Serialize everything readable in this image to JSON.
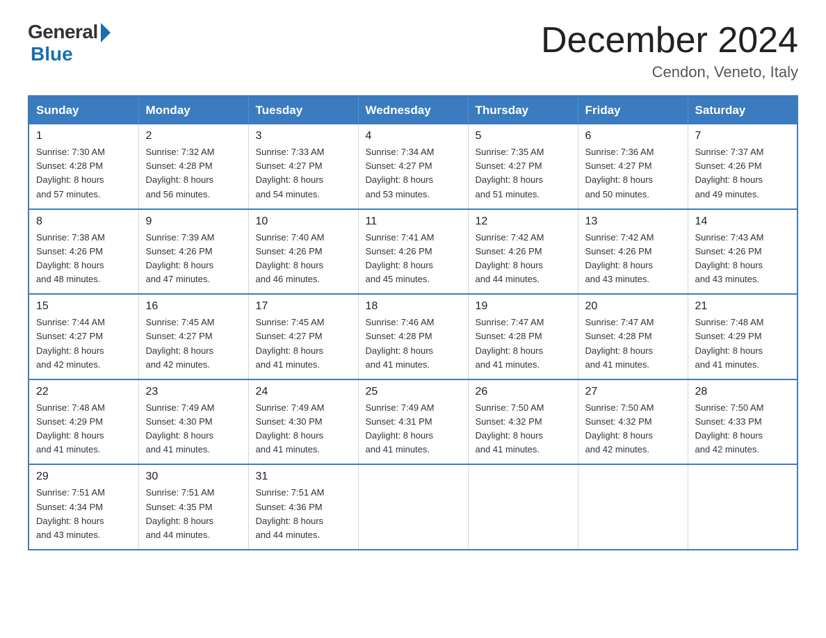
{
  "logo": {
    "general_text": "General",
    "blue_text": "Blue"
  },
  "title": "December 2024",
  "subtitle": "Cendon, Veneto, Italy",
  "days_of_week": [
    "Sunday",
    "Monday",
    "Tuesday",
    "Wednesday",
    "Thursday",
    "Friday",
    "Saturday"
  ],
  "weeks": [
    [
      {
        "day": "1",
        "sunrise": "Sunrise: 7:30 AM",
        "sunset": "Sunset: 4:28 PM",
        "daylight": "Daylight: 8 hours",
        "daylight2": "and 57 minutes."
      },
      {
        "day": "2",
        "sunrise": "Sunrise: 7:32 AM",
        "sunset": "Sunset: 4:28 PM",
        "daylight": "Daylight: 8 hours",
        "daylight2": "and 56 minutes."
      },
      {
        "day": "3",
        "sunrise": "Sunrise: 7:33 AM",
        "sunset": "Sunset: 4:27 PM",
        "daylight": "Daylight: 8 hours",
        "daylight2": "and 54 minutes."
      },
      {
        "day": "4",
        "sunrise": "Sunrise: 7:34 AM",
        "sunset": "Sunset: 4:27 PM",
        "daylight": "Daylight: 8 hours",
        "daylight2": "and 53 minutes."
      },
      {
        "day": "5",
        "sunrise": "Sunrise: 7:35 AM",
        "sunset": "Sunset: 4:27 PM",
        "daylight": "Daylight: 8 hours",
        "daylight2": "and 51 minutes."
      },
      {
        "day": "6",
        "sunrise": "Sunrise: 7:36 AM",
        "sunset": "Sunset: 4:27 PM",
        "daylight": "Daylight: 8 hours",
        "daylight2": "and 50 minutes."
      },
      {
        "day": "7",
        "sunrise": "Sunrise: 7:37 AM",
        "sunset": "Sunset: 4:26 PM",
        "daylight": "Daylight: 8 hours",
        "daylight2": "and 49 minutes."
      }
    ],
    [
      {
        "day": "8",
        "sunrise": "Sunrise: 7:38 AM",
        "sunset": "Sunset: 4:26 PM",
        "daylight": "Daylight: 8 hours",
        "daylight2": "and 48 minutes."
      },
      {
        "day": "9",
        "sunrise": "Sunrise: 7:39 AM",
        "sunset": "Sunset: 4:26 PM",
        "daylight": "Daylight: 8 hours",
        "daylight2": "and 47 minutes."
      },
      {
        "day": "10",
        "sunrise": "Sunrise: 7:40 AM",
        "sunset": "Sunset: 4:26 PM",
        "daylight": "Daylight: 8 hours",
        "daylight2": "and 46 minutes."
      },
      {
        "day": "11",
        "sunrise": "Sunrise: 7:41 AM",
        "sunset": "Sunset: 4:26 PM",
        "daylight": "Daylight: 8 hours",
        "daylight2": "and 45 minutes."
      },
      {
        "day": "12",
        "sunrise": "Sunrise: 7:42 AM",
        "sunset": "Sunset: 4:26 PM",
        "daylight": "Daylight: 8 hours",
        "daylight2": "and 44 minutes."
      },
      {
        "day": "13",
        "sunrise": "Sunrise: 7:42 AM",
        "sunset": "Sunset: 4:26 PM",
        "daylight": "Daylight: 8 hours",
        "daylight2": "and 43 minutes."
      },
      {
        "day": "14",
        "sunrise": "Sunrise: 7:43 AM",
        "sunset": "Sunset: 4:26 PM",
        "daylight": "Daylight: 8 hours",
        "daylight2": "and 43 minutes."
      }
    ],
    [
      {
        "day": "15",
        "sunrise": "Sunrise: 7:44 AM",
        "sunset": "Sunset: 4:27 PM",
        "daylight": "Daylight: 8 hours",
        "daylight2": "and 42 minutes."
      },
      {
        "day": "16",
        "sunrise": "Sunrise: 7:45 AM",
        "sunset": "Sunset: 4:27 PM",
        "daylight": "Daylight: 8 hours",
        "daylight2": "and 42 minutes."
      },
      {
        "day": "17",
        "sunrise": "Sunrise: 7:45 AM",
        "sunset": "Sunset: 4:27 PM",
        "daylight": "Daylight: 8 hours",
        "daylight2": "and 41 minutes."
      },
      {
        "day": "18",
        "sunrise": "Sunrise: 7:46 AM",
        "sunset": "Sunset: 4:28 PM",
        "daylight": "Daylight: 8 hours",
        "daylight2": "and 41 minutes."
      },
      {
        "day": "19",
        "sunrise": "Sunrise: 7:47 AM",
        "sunset": "Sunset: 4:28 PM",
        "daylight": "Daylight: 8 hours",
        "daylight2": "and 41 minutes."
      },
      {
        "day": "20",
        "sunrise": "Sunrise: 7:47 AM",
        "sunset": "Sunset: 4:28 PM",
        "daylight": "Daylight: 8 hours",
        "daylight2": "and 41 minutes."
      },
      {
        "day": "21",
        "sunrise": "Sunrise: 7:48 AM",
        "sunset": "Sunset: 4:29 PM",
        "daylight": "Daylight: 8 hours",
        "daylight2": "and 41 minutes."
      }
    ],
    [
      {
        "day": "22",
        "sunrise": "Sunrise: 7:48 AM",
        "sunset": "Sunset: 4:29 PM",
        "daylight": "Daylight: 8 hours",
        "daylight2": "and 41 minutes."
      },
      {
        "day": "23",
        "sunrise": "Sunrise: 7:49 AM",
        "sunset": "Sunset: 4:30 PM",
        "daylight": "Daylight: 8 hours",
        "daylight2": "and 41 minutes."
      },
      {
        "day": "24",
        "sunrise": "Sunrise: 7:49 AM",
        "sunset": "Sunset: 4:30 PM",
        "daylight": "Daylight: 8 hours",
        "daylight2": "and 41 minutes."
      },
      {
        "day": "25",
        "sunrise": "Sunrise: 7:49 AM",
        "sunset": "Sunset: 4:31 PM",
        "daylight": "Daylight: 8 hours",
        "daylight2": "and 41 minutes."
      },
      {
        "day": "26",
        "sunrise": "Sunrise: 7:50 AM",
        "sunset": "Sunset: 4:32 PM",
        "daylight": "Daylight: 8 hours",
        "daylight2": "and 41 minutes."
      },
      {
        "day": "27",
        "sunrise": "Sunrise: 7:50 AM",
        "sunset": "Sunset: 4:32 PM",
        "daylight": "Daylight: 8 hours",
        "daylight2": "and 42 minutes."
      },
      {
        "day": "28",
        "sunrise": "Sunrise: 7:50 AM",
        "sunset": "Sunset: 4:33 PM",
        "daylight": "Daylight: 8 hours",
        "daylight2": "and 42 minutes."
      }
    ],
    [
      {
        "day": "29",
        "sunrise": "Sunrise: 7:51 AM",
        "sunset": "Sunset: 4:34 PM",
        "daylight": "Daylight: 8 hours",
        "daylight2": "and 43 minutes."
      },
      {
        "day": "30",
        "sunrise": "Sunrise: 7:51 AM",
        "sunset": "Sunset: 4:35 PM",
        "daylight": "Daylight: 8 hours",
        "daylight2": "and 44 minutes."
      },
      {
        "day": "31",
        "sunrise": "Sunrise: 7:51 AM",
        "sunset": "Sunset: 4:36 PM",
        "daylight": "Daylight: 8 hours",
        "daylight2": "and 44 minutes."
      },
      {
        "day": "",
        "sunrise": "",
        "sunset": "",
        "daylight": "",
        "daylight2": ""
      },
      {
        "day": "",
        "sunrise": "",
        "sunset": "",
        "daylight": "",
        "daylight2": ""
      },
      {
        "day": "",
        "sunrise": "",
        "sunset": "",
        "daylight": "",
        "daylight2": ""
      },
      {
        "day": "",
        "sunrise": "",
        "sunset": "",
        "daylight": "",
        "daylight2": ""
      }
    ]
  ]
}
